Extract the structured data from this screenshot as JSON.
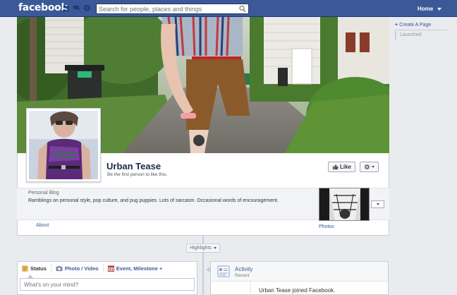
{
  "topbar": {
    "logo": "facebook",
    "search_placeholder": "Search for people, places and things",
    "home_label": "Home",
    "brand_color": "#3b5998",
    "icons": [
      "friends-icon",
      "messages-icon",
      "notifications-icon",
      "search-icon",
      "caret-down-icon"
    ]
  },
  "sidebar": {
    "create_page_label": "Create A Page",
    "launched_label": "Launched"
  },
  "page": {
    "name": "Urban Tease",
    "like_sub": "Be the first person to like this.",
    "like_label": "Like",
    "category": "Personal Blog",
    "about": "Ramblings on personal style, pop culture, and pug puppies. Lots of sarcasm. Occasional words of encouragement.",
    "about_link": "About",
    "photos_link": "Photos"
  },
  "timeline": {
    "highlights_label": "Highlights"
  },
  "composer": {
    "tabs": [
      {
        "label": "Status",
        "icon": "status-icon"
      },
      {
        "label": "Photo / Video",
        "icon": "camera-icon"
      },
      {
        "label": "Event, Milestone +",
        "icon": "calendar-icon"
      }
    ],
    "placeholder": "What's on your mind?"
  },
  "activity": {
    "title": "Activity",
    "subtitle": "Recent",
    "item": "Urban Tease joined Facebook."
  }
}
